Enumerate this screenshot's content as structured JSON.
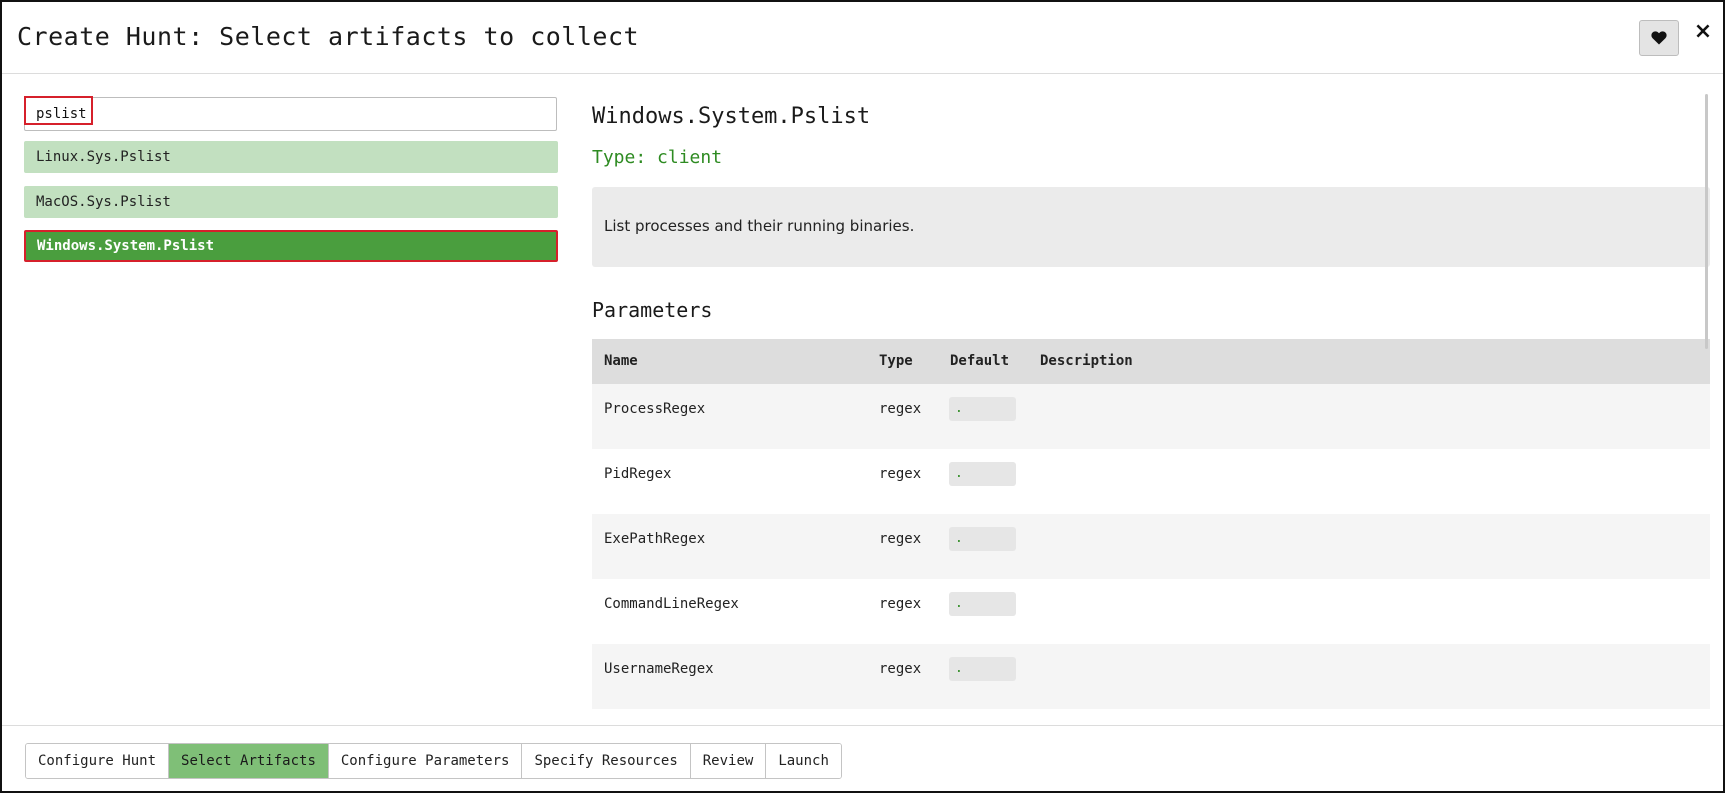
{
  "header": {
    "title": "Create Hunt: Select artifacts to collect",
    "favorite_icon": "heart-icon",
    "close_label": "×"
  },
  "search": {
    "value": "pslist",
    "placeholder": ""
  },
  "artifacts": [
    {
      "name": "Linux.Sys.Pslist",
      "selected": false
    },
    {
      "name": "MacOS.Sys.Pslist",
      "selected": false
    },
    {
      "name": "Windows.System.Pslist",
      "selected": true
    }
  ],
  "detail": {
    "title": "Windows.System.Pslist",
    "type": "Type: client",
    "description": "List processes and their running binaries.",
    "parameters_heading": "Parameters",
    "columns": [
      "Name",
      "Type",
      "Default",
      "Description"
    ],
    "rows": [
      {
        "name": "ProcessRegex",
        "type": "regex",
        "default": ".",
        "description": ""
      },
      {
        "name": "PidRegex",
        "type": "regex",
        "default": ".",
        "description": ""
      },
      {
        "name": "ExePathRegex",
        "type": "regex",
        "default": ".",
        "description": ""
      },
      {
        "name": "CommandLineRegex",
        "type": "regex",
        "default": ".",
        "description": ""
      },
      {
        "name": "UsernameRegex",
        "type": "regex",
        "default": ".",
        "description": ""
      }
    ]
  },
  "steps": [
    {
      "label": "Configure Hunt",
      "active": false
    },
    {
      "label": "Select Artifacts",
      "active": true
    },
    {
      "label": "Configure Parameters",
      "active": false
    },
    {
      "label": "Specify Resources",
      "active": false
    },
    {
      "label": "Review",
      "active": false
    },
    {
      "label": "Launch",
      "active": false
    }
  ],
  "colors": {
    "accent_green": "#4a9e3e",
    "light_green": "#c2e0c0",
    "type_green": "#2e8b22",
    "highlight_red": "#d6202b"
  }
}
